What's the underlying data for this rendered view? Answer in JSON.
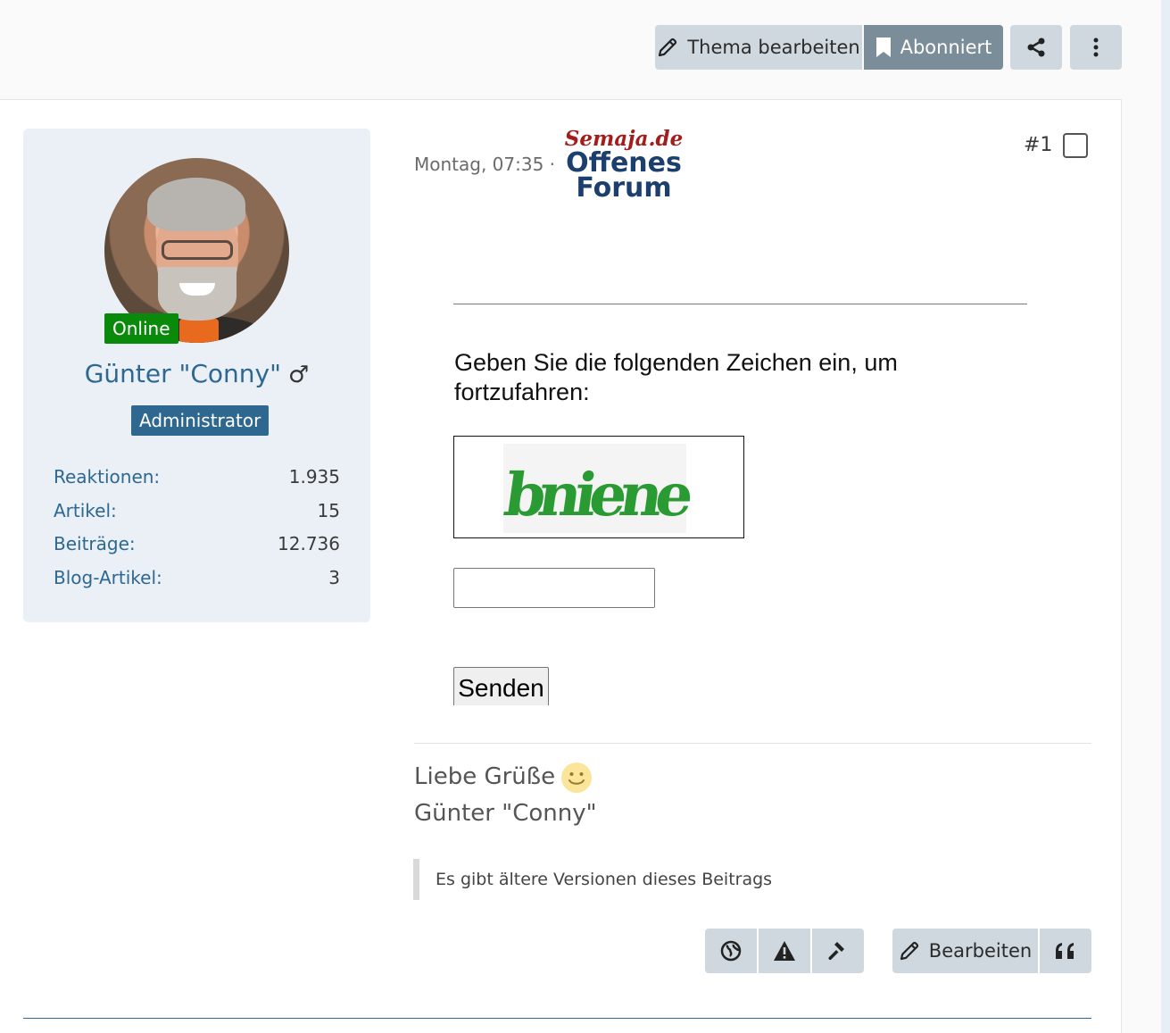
{
  "toolbar": {
    "edit_topic_label": "Thema bearbeiten",
    "subscribed_label": "Abonniert"
  },
  "author": {
    "online_label": "Online",
    "name": "Günter \"Conny\"",
    "gender_symbol": "♂",
    "role": "Administrator",
    "stats": [
      {
        "label": "Reaktionen:",
        "value": "1.935"
      },
      {
        "label": "Artikel:",
        "value": "15"
      },
      {
        "label": "Beiträge:",
        "value": "12.736"
      },
      {
        "label": "Blog-Artikel:",
        "value": "3"
      }
    ]
  },
  "post": {
    "date": "Montag, 07:35 ·",
    "logo_line1": "Semaja.de",
    "logo_line2": "Offenes",
    "logo_line3": "Forum",
    "number": "#1",
    "captcha_prompt": "Geben Sie die folgenden Zeichen ein, um fortzufahren:",
    "captcha_text": "bniene",
    "send_label": "Senden",
    "signature_line1": "Liebe Grüße",
    "signature_line2": "Günter \"Conny\"",
    "versions_note": "Es gibt ältere Versionen dieses Beitrags",
    "edit_label": "Bearbeiten"
  },
  "colors": {
    "accent": "#2e6890",
    "online": "#0a8a0a",
    "button_bg": "#cfd8de",
    "subscribed_bg": "#7b8d99"
  }
}
